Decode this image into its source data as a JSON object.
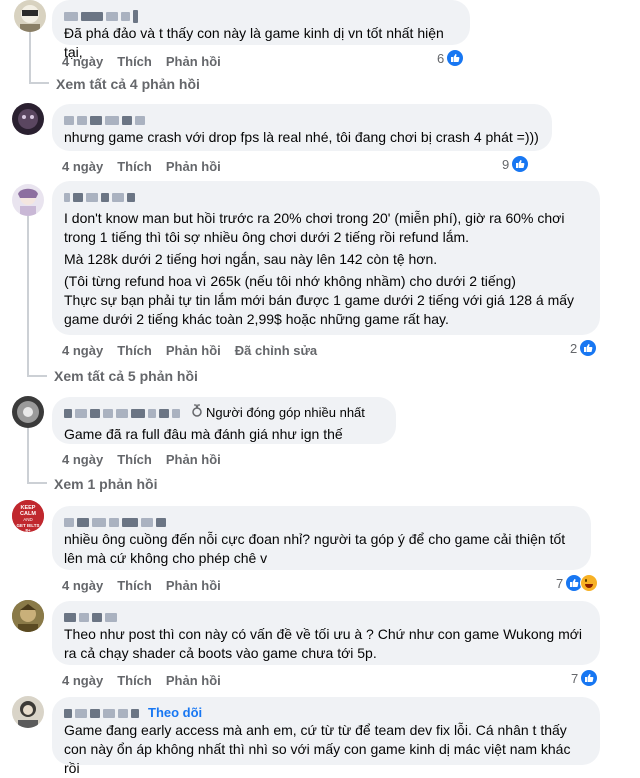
{
  "colors": {
    "link": "#1877f2",
    "meta": "#65676b",
    "bubble": "#f0f2f5"
  },
  "comments": [
    {
      "text": [
        "Đã phá đảo và t thấy con này là game kinh dị vn tốt nhất hiện tại,"
      ],
      "time": "4 ngày",
      "like": "Thích",
      "reply": "Phản hồi",
      "reaction_count": "6",
      "reactions": [
        "like-icon"
      ],
      "view_replies": "Xem tất cả 4 phản hồi"
    },
    {
      "text": [
        "nhưng game crash với drop fps là real nhé, tôi đang chơi bị crash 4 phát =)))"
      ],
      "time": "4 ngày",
      "like": "Thích",
      "reply": "Phản hồi",
      "reaction_count": "9",
      "reactions": [
        "like-icon"
      ]
    },
    {
      "text": [
        "I don't know man but hồi trước ra 20% chơi trong 20' (miễn phí), giờ ra 60% chơi trong 1 tiếng thì tôi sợ nhiều ông chơi dưới 2 tiếng rồi refund lắm.",
        "Mà 128k dưới 2 tiếng hơi ngắn, sau này lên 142 còn tệ hơn.",
        "(Tôi từng refund hoa vì 265k (nếu tôi nhớ không nhầm) cho dưới 2 tiếng)",
        "Thực sự bạn phải tự tin lắm mới bán được 1 game dưới 2 tiếng với giá 128 á mấy game dưới 2 tiếng khác toàn 2,99$ hoặc những game rất hay."
      ],
      "time": "4 ngày",
      "like": "Thích",
      "reply": "Phản hồi",
      "edited": "Đã chỉnh sửa",
      "reaction_count": "2",
      "reactions": [
        "like-icon"
      ],
      "view_replies": "Xem tất cả 5 phản hồi"
    },
    {
      "badge": "Người đóng góp nhiều nhất",
      "text": [
        "Game đã ra full đâu mà đánh giá như ign thế"
      ],
      "time": "4 ngày",
      "like": "Thích",
      "reply": "Phản hồi",
      "view_replies": "Xem 1 phản hồi"
    },
    {
      "avatar_text": "KEEP CALM AND GET IELTS 8+",
      "text": [
        "nhiều ông cuồng đến nỗi cực đoan nhỉ? người ta góp ý để cho game cải thiện tốt lên mà cứ không cho phép chê v"
      ],
      "time": "4 ngày",
      "like": "Thích",
      "reply": "Phản hồi",
      "reaction_count": "7",
      "reactions": [
        "like-icon",
        "haha-icon"
      ]
    },
    {
      "text": [
        "Theo như post thì con này có vấn đề về tối ưu à ? Chứ như con game Wukong mới ra cả chạy shader cả boots vào game chưa tới 5p."
      ],
      "time": "4 ngày",
      "like": "Thích",
      "reply": "Phản hồi",
      "reaction_count": "7",
      "reactions": [
        "like-icon"
      ]
    },
    {
      "follow": "Theo dõi",
      "text": [
        "Game đang early access mà anh em, cứ từ từ để team dev fix lỗi. Cá nhân t thấy con này ổn áp không nhất thì nhì so với mấy con game kinh dị mác việt nam khác rồi"
      ]
    }
  ]
}
